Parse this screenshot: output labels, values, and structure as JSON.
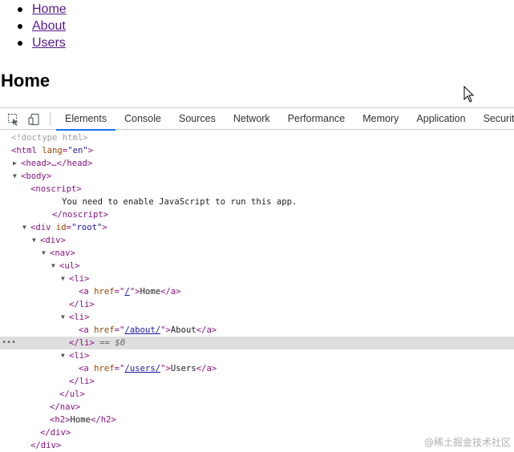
{
  "page": {
    "nav": [
      {
        "label": "Home"
      },
      {
        "label": "About"
      },
      {
        "label": "Users"
      }
    ],
    "heading": "Home"
  },
  "devtools": {
    "tabs": [
      "Elements",
      "Console",
      "Sources",
      "Network",
      "Performance",
      "Memory",
      "Application",
      "Security"
    ],
    "active_tab": "Elements",
    "tree": {
      "doctype": "<!doctype html>",
      "html_open": "<html",
      "html_attr": "lang",
      "html_attr_val": "\"en\"",
      "html_close_bracket": ">",
      "head_collapsed": "<head>…</head>",
      "body_open": "<body>",
      "noscript_open": "<noscript>",
      "noscript_text": "You need to enable JavaScript to run this app.",
      "noscript_close": "</noscript>",
      "div_root_open": "<div",
      "div_root_attr": "id",
      "div_root_val": "\"root\"",
      "div_open": "<div>",
      "nav_open": "<nav>",
      "ul_open": "<ul>",
      "li_open": "<li>",
      "li_close": "</li>",
      "a_open": "<a",
      "a_attr": "href",
      "links": [
        {
          "href": "/",
          "text": "Home"
        },
        {
          "href": "/about/",
          "text": "About"
        },
        {
          "href": "/users/",
          "text": "Users"
        }
      ],
      "a_close": "</a>",
      "selected_suffix": "== $0",
      "ul_close": "</ul>",
      "nav_close": "</nav>",
      "h2_open": "<h2>",
      "h2_text": "Home",
      "h2_close": "</h2>",
      "div_close": "</div>"
    }
  },
  "watermark": "@稀土掘金技术社区",
  "colors": {
    "tag": "#881280",
    "attr": "#994500",
    "value": "#1a1aa6",
    "active_tab_underline": "#1a73e8",
    "selected_row": "#dedede"
  }
}
